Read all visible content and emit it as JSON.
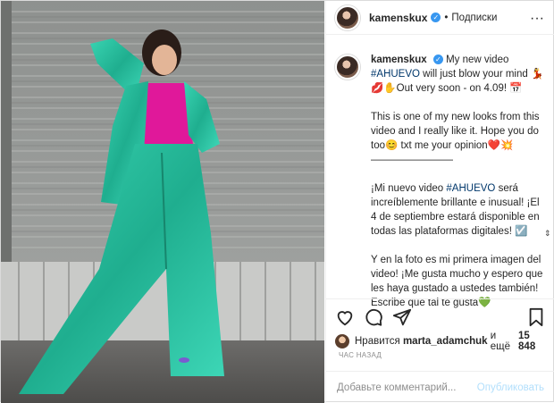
{
  "header": {
    "username": "kamenskux",
    "separator": "•",
    "follow_label": "Подписки",
    "more_label": "···"
  },
  "caption": {
    "username": "kamenskux",
    "line1_pre": "My new video",
    "hashtag1": "#AHUEVO",
    "line1_post": "will just blow your mind",
    "line2": "Out very soon - on 4.09!",
    "para2": "This is one of my new looks from this video and I really like it. Hope you do too",
    "para2_end": "txt me your opinion",
    "divider": "————————",
    "para3_pre": "¡Mi nuevo video",
    "hashtag2": "#AHUEVO",
    "para3_post": "será increíblemente brillante e inusual! ¡El 4 de septiembre estará disponible en todas las plataformas digitales!",
    "para4": "Y en la foto es mi primera imagen del video! ¡Me gusta mucho y espero que les haya gustado a ustedes también! Escribe que tal te gusta"
  },
  "likes": {
    "prefix": "Нравится",
    "user": "marta_adamchuk",
    "middle": "и ещё",
    "count": "15 848"
  },
  "time_label": "ЧАС НАЗАД",
  "comment": {
    "placeholder": "Добавьте комментарий...",
    "publish_label": "Опубликовать"
  },
  "colors": {
    "suit": "#2ec4a3",
    "blouse": "#e0189a",
    "link": "#00376b",
    "publish_disabled": "#b2dffc"
  },
  "icons": [
    "verified-icon",
    "more-options-icon",
    "heart-icon",
    "comment-icon",
    "share-icon",
    "bookmark-icon"
  ]
}
